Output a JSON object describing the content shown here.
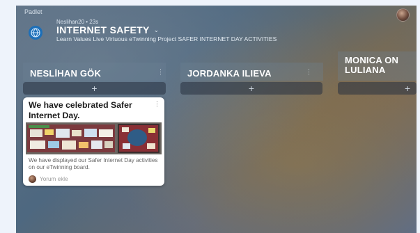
{
  "app": {
    "name": "Padlet"
  },
  "header": {
    "author": "Neslihan20",
    "time": "23s",
    "title": "INTERNET SAFETY",
    "subtitle": "Learn Values Live Virtuous eTwinning Project SAFER INTERNET DAY ACTIVITIES"
  },
  "columns": [
    {
      "label": "NESLİHAN GÖK",
      "more": "⋮",
      "add": "+"
    },
    {
      "label": "JORDANKA ILIEVA",
      "more": "⋮",
      "add": "+"
    },
    {
      "label_line1": "MONICA ON",
      "label_line2": "LULIANA",
      "add": "+"
    }
  ],
  "post": {
    "title": "We have celebrated Safer Internet Day.",
    "more": "⋮",
    "description": "We have displayed our Safer Internet Day activities on our eTwinning board.",
    "comment": "Yorum ekle"
  },
  "icons": {
    "padlet": "globe-icon",
    "chevron": "chevron-down-icon",
    "more": "more-vertical-icon",
    "add": "plus-icon"
  },
  "colors": {
    "accent": "#1d6fb8",
    "card_bg": "#ffffff"
  }
}
